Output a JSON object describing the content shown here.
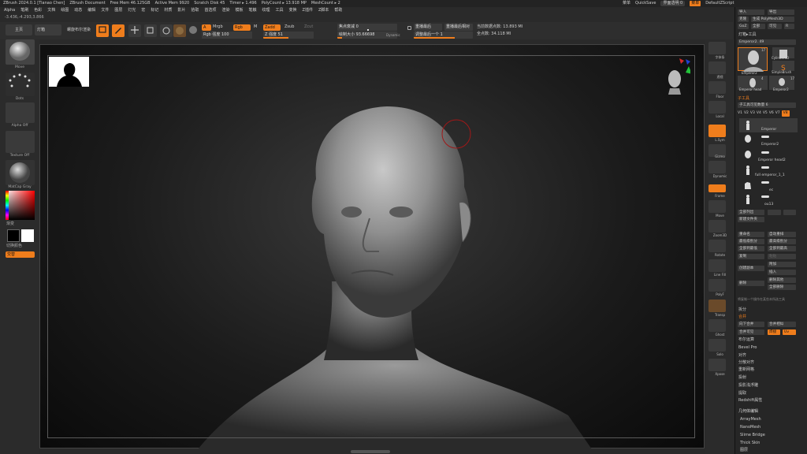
{
  "titlebar": {
    "items": [
      "ZBrush 2024.0.1 [Tianao Chen]",
      "ZBrush Document",
      "Free Mem 46.125GB",
      "Active Mem 9920",
      "Scratch Disk 45",
      "Timer ▸ 1.496",
      "PolyCount ▸ 13.918 MP",
      "MeshCount ▸ 2"
    ],
    "right": {
      "menu": "菜单",
      "quicksave": "QuickSave",
      "transparency": "界面透明 0",
      "menus_btn": "菜单",
      "script": "DefaultZScript"
    }
  },
  "menubar": {
    "items": [
      "Alpha",
      "笔刷",
      "色彩",
      "文档",
      "绘图",
      "动态",
      "编辑",
      "文件",
      "图层",
      "灯光",
      "宏",
      "标记",
      "材质",
      "影片",
      "拾取",
      "首选项",
      "渲染",
      "模板",
      "笔触",
      "纹理",
      "工具",
      "变换",
      "Z插件",
      "Z脚本",
      "帮助"
    ]
  },
  "coords": "-3.436,-4.293,3.866",
  "toolbar": {
    "home": "主页",
    "lightbox": "灯箱",
    "lightbox_label": "螺旋布尔渲染",
    "icons": [
      {
        "name": "edit",
        "label": "Edit",
        "on": true
      },
      {
        "name": "draw",
        "label": "Draw",
        "on": true
      },
      {
        "name": "move",
        "label": "Move",
        "on": false
      },
      {
        "name": "scale",
        "label": "Scale",
        "on": false
      },
      {
        "name": "rotate",
        "label": "Rotate",
        "on": false
      }
    ],
    "mrgb": "A",
    "mrgb_label": "Mrgb",
    "rgb": "Rgb",
    "m": "M",
    "rgb_intensity": "Rgb 强度 100",
    "zadd": "Zadd",
    "zsub": "Zsub",
    "zcut": "Zcut",
    "z_intensity": "Z 强度 51",
    "focal_shift": "焦点衰减 0",
    "draw_size": "绘制大小 93.66698",
    "dynamic": "Dynamic",
    "replay_last": "重播最后",
    "replay_last_rel": "重播最后相对",
    "adjust_last": "调整最后一个 1",
    "active_points": "当前数据点数: 13.893 MI",
    "total_points": "全点数: 34.118 MI"
  },
  "leftshelf": {
    "brush": "Move",
    "stroke": "Dots",
    "alpha": "Alpha Off",
    "texture": "Texture Off",
    "material": "MatCap Gray",
    "gradient": "渐变",
    "switch_color": "切换颜色",
    "alternate": "交替"
  },
  "rightshelf": {
    "buttons": [
      "字体条",
      "透视",
      "Floor",
      "Local",
      "L.Sym",
      "Gizmo",
      "Dynamic",
      "Frame",
      "Move",
      "Zoom3D",
      "Rotate",
      "Line Fill",
      "PolyF",
      "Transp",
      "Ghost",
      "Solo",
      "Xpose"
    ]
  },
  "rpanel": {
    "top": [
      "导入",
      "导出",
      "克隆",
      "生成 PolyMesh3D",
      "GoZ",
      "全部",
      "可见",
      "R"
    ],
    "lightbox_tools": "灯箱▸工具",
    "tool_name": "Emperor2. 49",
    "tool_thumbs": [
      {
        "name": "Emperor2",
        "count": "17"
      },
      {
        "name": "Cylinder3D",
        "count": ""
      },
      {
        "name": "SimpleBrush",
        "count": ""
      },
      {
        "name": "Emperor head",
        "count": "4"
      },
      {
        "name": "Emperor2",
        "count": "17"
      }
    ],
    "subtool_header": "子工具",
    "subtool_count": "子工具可见数量 6",
    "v_buttons": [
      "V1",
      "V2",
      "V3",
      "V4",
      "V5",
      "V6",
      "V7",
      "V8"
    ],
    "subtools": [
      "Emperor",
      "Emperor2",
      "Emperor head2",
      "full emperor_1_1",
      "ec",
      "ou13"
    ],
    "list_all": "全部列出",
    "new_folder": "新建文件夹",
    "rename": "重命名",
    "auto_reorder": "自动重排",
    "all_low": "最低级别分",
    "all_high": "最高级别分",
    "all_to_lowest": "全部到最低",
    "all_to_highest": "全部到最高",
    "copy": "复制",
    "paste": "粘贴",
    "append": "附加",
    "duplicate": "创建副本",
    "insert": "插入",
    "delete": "删除",
    "delete_other": "删除其他",
    "delete_all": "全部删除",
    "note": "将复制一个操作在某些本所选工具",
    "split": "拆分",
    "merge": "合并",
    "merge_down": "向下合并",
    "merge_similar": "合并相似",
    "merge_visible": "合并可见",
    "weld": "焊接",
    "uv": "Uv",
    "boolean": "布尔运算",
    "bevel_pro": "Bevel Pro",
    "align": "对齐",
    "distribute": "分散对齐",
    "remesh": "重新网格",
    "project": "投射",
    "project_bas": "投影浅浮雕",
    "extract": "提取",
    "redshift": "Redshift属性",
    "geom_editing": "几何体编辑",
    "geom_items": [
      "ArrayMesh",
      "NanoMesh",
      "Slime Bridge",
      "Thick Skin",
      "图层"
    ]
  }
}
